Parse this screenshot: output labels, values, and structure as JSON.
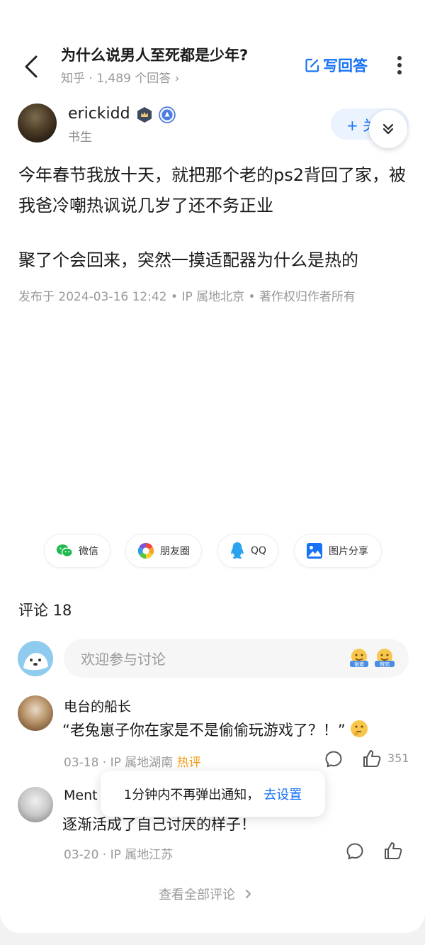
{
  "header": {
    "question_title": "为什么说男人至死都是少年?",
    "sub": "知乎 · 1,489 个回答 ›",
    "write_label": "写回答"
  },
  "author": {
    "name": "erickidd",
    "tag": "书生",
    "follow_label": "+ 关"
  },
  "answer": {
    "paragraph1": "今年春节我放十天，就把那个老的ps2背回了家，被我爸冷嘲热讽说几岁了还不务正业",
    "paragraph2": "聚了个会回来，突然一摸适配器为什么是热的",
    "meta": "发布于 2024-03-16 12:42 • IP 属地北京 • 著作权归作者所有"
  },
  "share": {
    "wechat": "微信",
    "moments": "朋友圈",
    "qq": "QQ",
    "image": "图片分享"
  },
  "comments": {
    "header": "评论 18",
    "input_placeholder": "欢迎参与讨论",
    "emoji_a": "谢邀",
    "emoji_b": "赞同",
    "items": [
      {
        "name": "电台的船长",
        "text": "“老兔崽子你在家是不是偷偷玩游戏了？！”",
        "date": "03-18 ·",
        "ip": "IP 属地湖南",
        "badge": "热评",
        "likes": "351"
      },
      {
        "name": "Ment",
        "text": "逐渐活成了自己讨厌的样子！",
        "date": "03-20 ·",
        "ip": "IP 属地江苏"
      }
    ],
    "view_all": "查看全部评论"
  },
  "toast": {
    "text": "1分钟内不再弹出通知，",
    "link": "去设置"
  },
  "colors": {
    "accent": "#1772f6",
    "hot": "#f39d1a",
    "muted": "#999999"
  }
}
